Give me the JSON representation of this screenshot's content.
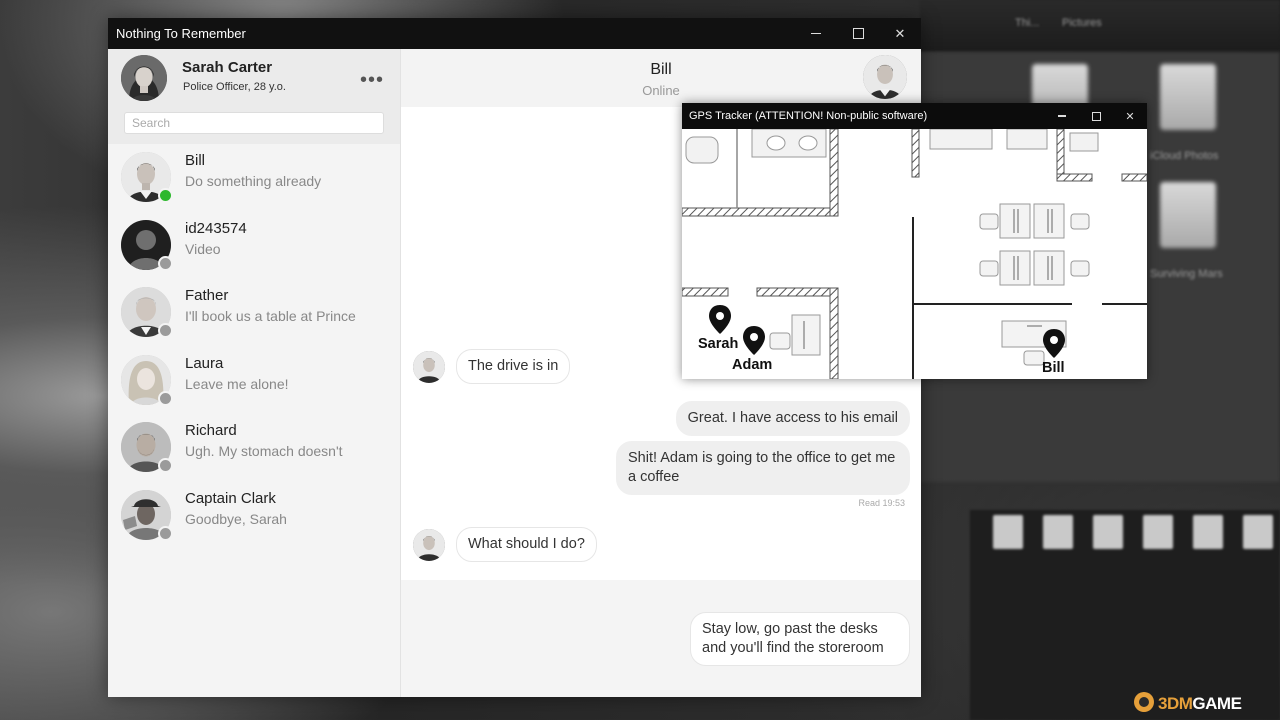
{
  "window": {
    "title": "Nothing To Remember"
  },
  "profile": {
    "name": "Sarah Carter",
    "subtitle": "Police Officer, 28 y.o."
  },
  "search": {
    "placeholder": "Search"
  },
  "contacts": [
    {
      "name": "Bill",
      "last_message": "Do something already",
      "status": "online"
    },
    {
      "name": "id243574",
      "last_message": "Video",
      "status": "offline"
    },
    {
      "name": "Father",
      "last_message": "I'll book us a table at Prince",
      "status": "offline"
    },
    {
      "name": "Laura",
      "last_message": "Leave me alone!",
      "status": "offline"
    },
    {
      "name": "Richard",
      "last_message": "Ugh. My stomach doesn't",
      "status": "offline"
    },
    {
      "name": "Captain Clark",
      "last_message": "Goodbye, Sarah",
      "status": "offline"
    }
  ],
  "chat": {
    "contact_name": "Bill",
    "contact_status": "Online",
    "messages": [
      {
        "direction": "in",
        "text": "The drive is in"
      },
      {
        "direction": "out",
        "text": "Great. I have access to his email"
      },
      {
        "direction": "out",
        "text": "Shit! Adam is going to the office to get me a coffee"
      },
      {
        "direction": "in",
        "text": "What should I do?"
      }
    ],
    "read_receipt": "Read 19:53",
    "reply_option": "Stay low, go past the desks and you'll find the storeroom"
  },
  "gps": {
    "title": "GPS Tracker (ATTENTION! Non-public software)",
    "pins": [
      {
        "label": "Sarah"
      },
      {
        "label": "Adam"
      },
      {
        "label": "Bill"
      }
    ]
  },
  "desktop": {
    "path_crumb_1": "Thi...",
    "path_crumb_2": "Pictures",
    "folder_1": "iCloud Photos",
    "folder_2": "Surviving Mars",
    "watermark_1": "3DM",
    "watermark_2": "GAME"
  },
  "colors": {
    "online": "#2db82d",
    "offline": "#9b9b9b",
    "titlebar": "#111111",
    "watermark": "#e6a03a"
  }
}
